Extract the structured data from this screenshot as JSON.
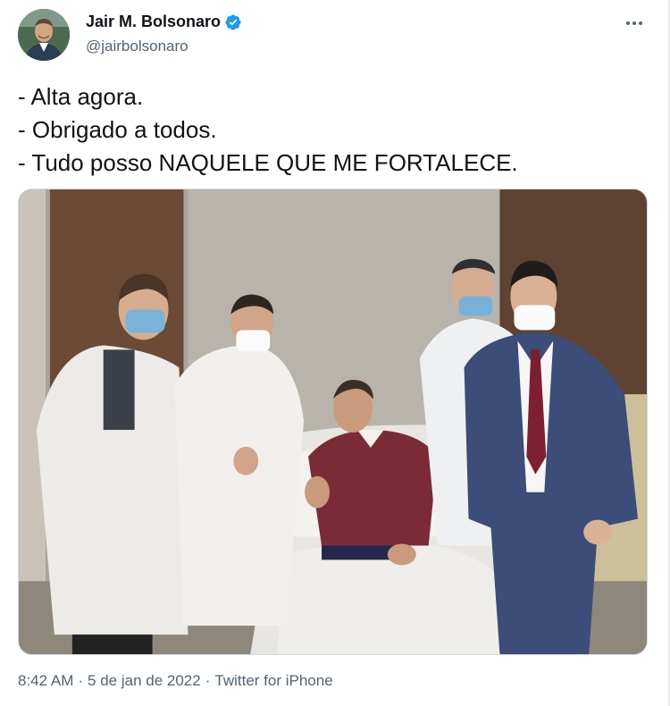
{
  "author": {
    "display_name": "Jair M. Bolsonaro",
    "handle": "@jairbolsonaro",
    "verified": true
  },
  "tweet": {
    "lines": [
      "- Alta agora.",
      "- Obrigado a todos.",
      "- Tudo posso NAQUELE QUE ME FORTALECE."
    ]
  },
  "meta": {
    "time": "8:42 AM",
    "date": "5 de jan de 2022",
    "source": "Twitter for iPhone",
    "separator": "·"
  },
  "icons": {
    "more": "more-dots-icon",
    "verified": "verified-badge-icon"
  },
  "colors": {
    "accent": "#1d9bf0",
    "secondary_text": "#536471",
    "primary_text": "#0f1419"
  }
}
